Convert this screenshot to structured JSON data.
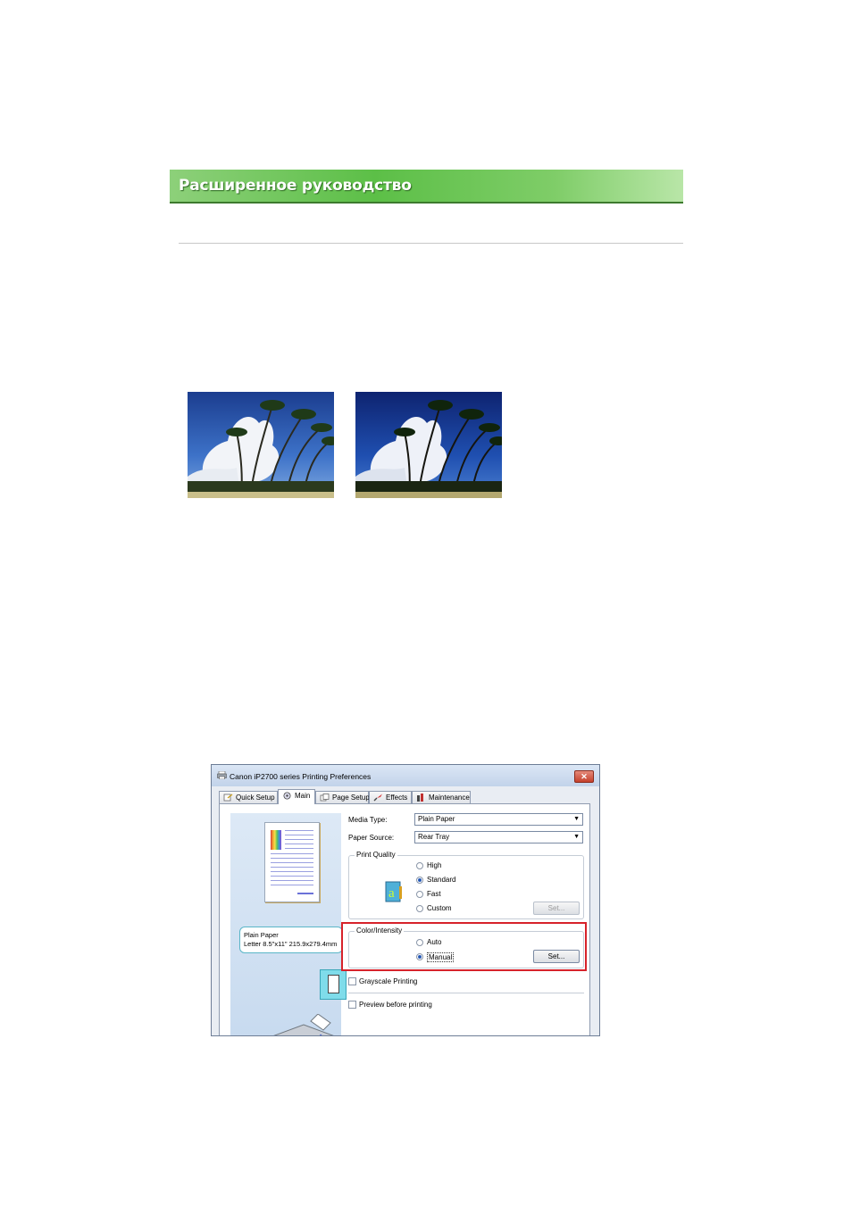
{
  "header": {
    "title": "Расширенное руководство"
  },
  "colors": {
    "banner": "#5cbf47",
    "highlight": "#d7222a"
  },
  "photos": [
    {
      "name": "palms-before"
    },
    {
      "name": "palms-after"
    }
  ],
  "dialog": {
    "title": "Canon iP2700 series Printing Preferences",
    "close_label": "✕",
    "tabs": [
      {
        "label": "Quick Setup",
        "icon": "quick-setup-icon"
      },
      {
        "label": "Main",
        "icon": "main-icon"
      },
      {
        "label": "Page Setup",
        "icon": "page-setup-icon"
      },
      {
        "label": "Effects",
        "icon": "effects-icon"
      },
      {
        "label": "Maintenance",
        "icon": "maintenance-icon"
      }
    ],
    "preview": {
      "info_line1": "Plain Paper",
      "info_line2": "Letter 8.5\"x11\" 215.9x279.4mm"
    },
    "media_type": {
      "label": "Media Type:",
      "value": "Plain Paper"
    },
    "paper_source": {
      "label": "Paper Source:",
      "value": "Rear Tray"
    },
    "print_quality": {
      "label": "Print Quality",
      "options": [
        {
          "label": "High",
          "selected": false
        },
        {
          "label": "Standard",
          "selected": true
        },
        {
          "label": "Fast",
          "selected": false
        },
        {
          "label": "Custom",
          "selected": false
        }
      ],
      "set_label": "Set..."
    },
    "color_intensity": {
      "label": "Color/Intensity",
      "options": [
        {
          "label": "Auto",
          "selected": false
        },
        {
          "label": "Manual",
          "selected": true
        }
      ],
      "set_label": "Set..."
    },
    "grayscale": {
      "label": "Grayscale Printing",
      "checked": false
    },
    "preview_before": {
      "label": "Preview before printing",
      "checked": false
    }
  }
}
